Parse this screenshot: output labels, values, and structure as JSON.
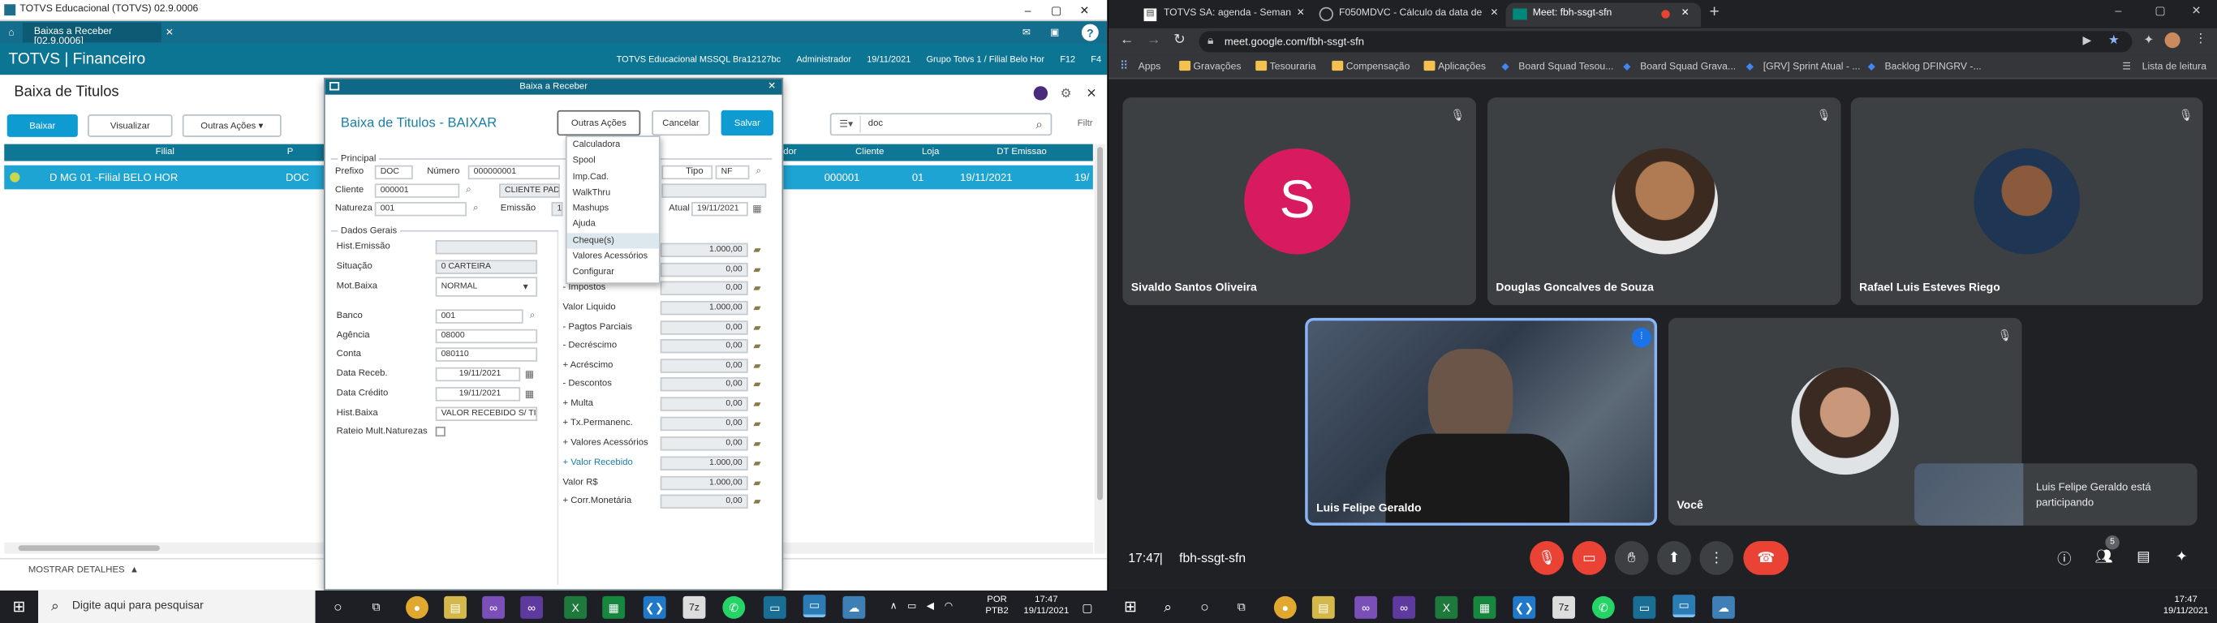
{
  "left_app": {
    "window_title": "TOTVS Educacional (TOTVS) 02.9.0006",
    "tab_label": "Baixas a Receber [02.9.0006]",
    "header_title": "TOTVS | Financeiro",
    "header_info": [
      "TOTVS Educacional MSSQL Bra12127bc",
      "Administrador",
      "19/11/2021",
      "Grupo Totvs 1 / Filial Belo Hor",
      "F12",
      "F4"
    ],
    "page_title": "Baixa de Titulos",
    "buttons": {
      "baixar": "Baixar",
      "visualizar": "Visualizar",
      "outras": "Outras Ações"
    },
    "search_value": "doc",
    "filter_label": "Filtr",
    "grid_headers": {
      "filial": "Filial",
      "p": "P",
      "dor": "dor",
      "cliente": "Cliente",
      "loja": "Loja",
      "dt_emissao": "DT Emissao"
    },
    "grid_row": {
      "filial": "D MG 01 -Filial BELO HOR",
      "prefixo": "DOC",
      "cliente": "000001",
      "loja": "01",
      "dt": "19/11/2021",
      "extra": "19/"
    },
    "mostrar": "MOSTRAR DETALHES"
  },
  "dialog": {
    "window_title": "Baixa a Receber",
    "title": "Baixa de Titulos - BAIXAR",
    "outras": "Outras Ações",
    "cancelar": "Cancelar",
    "salvar": "Salvar",
    "principal": "Principal",
    "prefixo_label": "Prefixo",
    "prefixo": "DOC",
    "numero_label": "Número",
    "numero": "000000001",
    "tipo_label": "Tipo",
    "tipo": "NF",
    "cliente_label": "Cliente",
    "cliente": "000001",
    "cliente_nome": "CLIENTE PADR",
    "natureza_label": "Natureza",
    "natureza": "001",
    "emissao_label": "Emissão",
    "emissao": "1",
    "data_atual_label": "Atual",
    "data_atual": "19/11/2021",
    "dados_gerais": "Dados Gerais",
    "left_fields": [
      {
        "label": "Hist.Emissão",
        "value": ""
      },
      {
        "label": "Situação",
        "value": "0 CARTEIRA"
      },
      {
        "label": "Mot.Baixa",
        "value": "NORMAL"
      },
      {
        "label": "Banco",
        "value": "001"
      },
      {
        "label": "Agência",
        "value": "08000"
      },
      {
        "label": "Conta",
        "value": "080110"
      },
      {
        "label": "Data Receb.",
        "value": "19/11/2021"
      },
      {
        "label": "Data Crédito",
        "value": "19/11/2021"
      },
      {
        "label": "Hist.Baixa",
        "value": "VALOR RECEBIDO S/ TIT"
      },
      {
        "label": "Rateio Mult.Naturezas",
        "value": ""
      }
    ],
    "right_fields": [
      {
        "label": "",
        "value": "1.000,00"
      },
      {
        "label": "",
        "value": "0,00"
      },
      {
        "label": "- Impostos",
        "value": "0,00"
      },
      {
        "label": "Valor Liquido",
        "value": "1.000,00"
      },
      {
        "label": "- Pagtos Parciais",
        "value": "0,00"
      },
      {
        "label": "- Decréscimo",
        "value": "0,00"
      },
      {
        "label": "+ Acréscimo",
        "value": "0,00"
      },
      {
        "label": "- Descontos",
        "value": "0,00"
      },
      {
        "label": "+ Multa",
        "value": "0,00"
      },
      {
        "label": "+ Tx.Permanenc.",
        "value": "0,00"
      },
      {
        "label": "+ Valores Acessórios",
        "value": "0,00"
      },
      {
        "label": "+ Valor Recebido",
        "value": "1.000,00"
      },
      {
        "label": "Valor R$",
        "value": "1.000,00"
      },
      {
        "label": "+ Corr.Monetária",
        "value": "0,00"
      }
    ],
    "menu": [
      "Calculadora",
      "Spool",
      "Imp.Cad.",
      "WalkThru",
      "Mashups",
      "Ajuda",
      "Cheque(s)",
      "Valores Acessórios",
      "Configurar"
    ]
  },
  "taskbar_left": {
    "search": "Digite aqui para pesquisar",
    "lang1": "POR",
    "lang2": "PTB2",
    "time": "17:47",
    "date": "19/11/2021"
  },
  "browser": {
    "tabs": [
      "TOTVS SA: agenda - Semana de",
      "F050MDVC - Cálculo da data de",
      "Meet: fbh-ssgt-sfn"
    ],
    "url": "meet.google.com/fbh-ssgt-sfn",
    "bookmarks": [
      "Apps",
      "Gravações",
      "Tesouraria",
      "Compensação",
      "Aplicações",
      "Board Squad Tesou...",
      "Board Squad Grava...",
      "[GRV] Sprint Atual - ...",
      "Backlog DFINGRV -..."
    ],
    "reading_list": "Lista de leitura",
    "participants": [
      "Sivaldo Santos Oliveira",
      "Douglas Goncalves de Souza",
      "Rafael Luis Esteves Riego",
      "Luis Felipe Geraldo",
      "Você"
    ],
    "avatar_letter": "S",
    "toast": "Luis Felipe Geraldo está participando",
    "meeting_time": "17:47",
    "meeting_code": "fbh-ssgt-sfn",
    "people_count": "5",
    "accent_red": "#ea4335",
    "avatar_color": "#d81b60"
  },
  "taskbar_right": {
    "time": "17:47",
    "date": "19/11/2021"
  }
}
